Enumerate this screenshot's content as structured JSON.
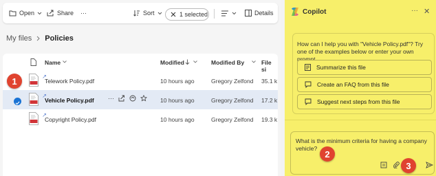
{
  "toolbar": {
    "open_label": "Open",
    "share_label": "Share",
    "more_label": "···",
    "sort_label": "Sort",
    "selected_label": "1 selected",
    "details_label": "Details"
  },
  "breadcrumb": {
    "root": "My files",
    "current": "Policies"
  },
  "table": {
    "headers": [
      "Name",
      "Modified",
      "Modified By",
      "File si"
    ],
    "rows": [
      {
        "name": "Telework Policy.pdf",
        "modified": "10 hours ago",
        "modified_by": "Gregory Zelfond",
        "size": "35.1 k",
        "selected": false
      },
      {
        "name": "Vehicle Policy.pdf",
        "modified": "10 hours ago",
        "modified_by": "Gregory Zelfond",
        "size": "17.2 k",
        "selected": true
      },
      {
        "name": "Copyright Policy.pdf",
        "modified": "10 hours ago",
        "modified_by": "Gregory Zelfond",
        "size": "19.3 k",
        "selected": false
      }
    ]
  },
  "badges": {
    "one": "1",
    "two": "2",
    "three": "3"
  },
  "copilot": {
    "title": "Copilot",
    "more": "···",
    "close": "✕",
    "intro": "How can I help you with \"Vehicle Policy.pdf\"? Try one of the examples below or enter your own prompt.",
    "suggestions": [
      "Summarize this file",
      "Create an FAQ from this file",
      "Suggest next steps from this file"
    ],
    "input_value": "What is the minimum criteria for having a company vehicle?"
  },
  "colors": {
    "copilot_bg": "#f7ef6a",
    "badge": "#e0432f",
    "selection": "#e3eaf5",
    "accent": "#1a73d4"
  }
}
